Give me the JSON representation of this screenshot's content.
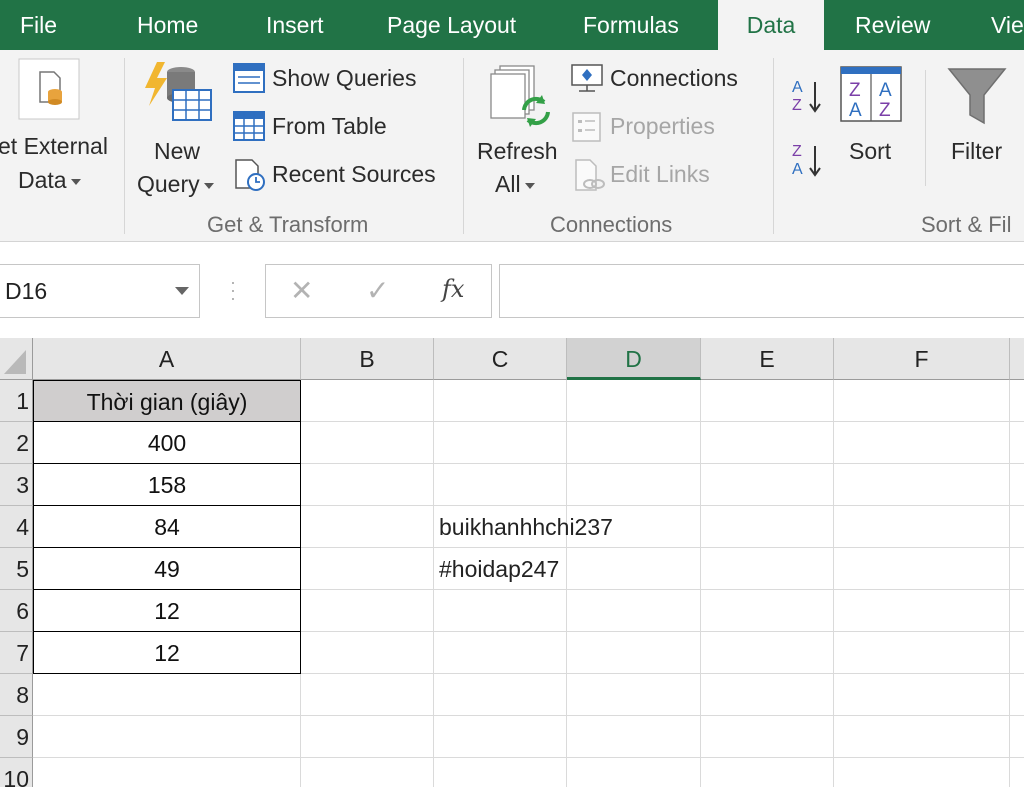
{
  "tabs": [
    {
      "label": "File"
    },
    {
      "label": "Home"
    },
    {
      "label": "Insert"
    },
    {
      "label": "Page Layout"
    },
    {
      "label": "Formulas"
    },
    {
      "label": "Data",
      "active": true
    },
    {
      "label": "Review"
    },
    {
      "label": "Vie"
    }
  ],
  "ribbon": {
    "get_external": {
      "line1": "et External",
      "line2": "Data"
    },
    "new_query": {
      "line1": "New",
      "line2": "Query"
    },
    "show_queries": "Show Queries",
    "from_table": "From Table",
    "recent_sources": "Recent Sources",
    "group_get_transform": "Get & Transform",
    "refresh": {
      "line1": "Refresh",
      "line2": "All"
    },
    "connections": "Connections",
    "properties": "Properties",
    "edit_links": "Edit Links",
    "group_connections": "Connections",
    "sort_az": {
      "top": "A",
      "bottom": "Z"
    },
    "sort_za": {
      "top": "Z",
      "bottom": "A"
    },
    "sort": "Sort",
    "sort_icon": {
      "tl": "Z",
      "tr": "A",
      "bl": "A",
      "br": "Z"
    },
    "filter": "Filter",
    "group_sort_filter": "Sort & Fil",
    "colors": {
      "accent": "#217346",
      "sort_purple": "#7b3fa8",
      "sort_blue": "#2f6fc0"
    }
  },
  "formula_bar": {
    "name_box": "D16",
    "cancel_icon": "✕",
    "enter_icon": "✓",
    "fx_label": "fx",
    "formula": ""
  },
  "sheet": {
    "columns": [
      "A",
      "B",
      "C",
      "D",
      "E",
      "F"
    ],
    "selected_column": "D",
    "rows": [
      "1",
      "2",
      "3",
      "4",
      "5",
      "6",
      "7",
      "8",
      "9",
      "10"
    ],
    "column_a": [
      "Thời gian (giây)",
      "400",
      "158",
      "84",
      "49",
      "12",
      "12"
    ],
    "c4": "buikhanhhchi237",
    "c5": "#hoidap247",
    "header_fill": "#d0cece"
  }
}
